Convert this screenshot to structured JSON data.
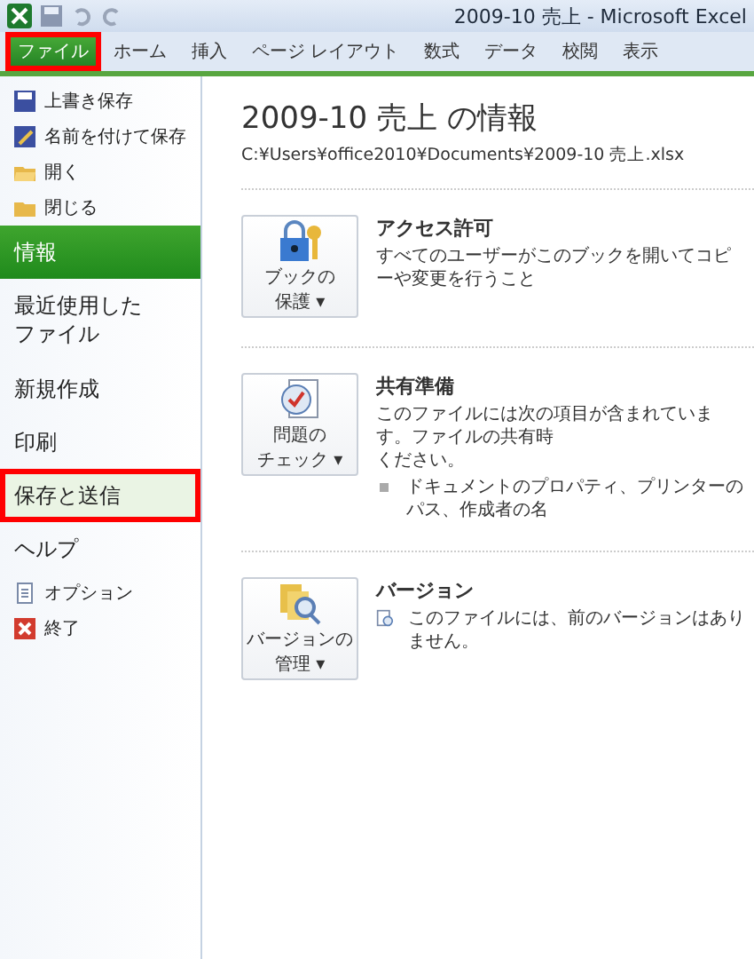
{
  "window": {
    "title": "2009-10 売上 - Microsoft Excel"
  },
  "tabs": [
    {
      "label": "ファイル",
      "kind": "file",
      "selected": true,
      "highlighted": true
    },
    {
      "label": "ホーム",
      "kind": "tab",
      "selected": false,
      "highlighted": false
    },
    {
      "label": "挿入",
      "kind": "tab",
      "selected": false,
      "highlighted": false
    },
    {
      "label": "ページ レイアウト",
      "kind": "tab",
      "selected": false,
      "highlighted": false
    },
    {
      "label": "数式",
      "kind": "tab",
      "selected": false,
      "highlighted": false
    },
    {
      "label": "データ",
      "kind": "tab",
      "selected": false,
      "highlighted": false
    },
    {
      "label": "校閲",
      "kind": "tab",
      "selected": false,
      "highlighted": false
    },
    {
      "label": "表示",
      "kind": "tab",
      "selected": false,
      "highlighted": false
    }
  ],
  "sidebar": {
    "items": [
      {
        "label": "上書き保存",
        "kind": "small",
        "selected": false,
        "highlighted": false
      },
      {
        "label": "名前を付けて保存",
        "kind": "small",
        "selected": false,
        "highlighted": false
      },
      {
        "label": "開く",
        "kind": "small",
        "selected": false,
        "highlighted": false
      },
      {
        "label": "閉じる",
        "kind": "small",
        "selected": false,
        "highlighted": false
      },
      {
        "label": "情報",
        "kind": "large",
        "selected": true,
        "highlighted": false
      },
      {
        "lines": [
          "最近使用した",
          "ファイル"
        ],
        "kind": "large",
        "selected": false,
        "highlighted": false
      },
      {
        "label": "新規作成",
        "kind": "large",
        "selected": false,
        "highlighted": false
      },
      {
        "label": "印刷",
        "kind": "large",
        "selected": false,
        "highlighted": false
      },
      {
        "label": "保存と送信",
        "kind": "large",
        "selected": false,
        "highlighted": true
      },
      {
        "label": "ヘルプ",
        "kind": "large",
        "selected": false,
        "highlighted": false
      },
      {
        "label": "オプション",
        "kind": "small",
        "selected": false,
        "highlighted": false
      },
      {
        "label": "終了",
        "kind": "small",
        "selected": false,
        "highlighted": false
      }
    ]
  },
  "info": {
    "title": "2009-10 売上 の情報",
    "path": "C:¥Users¥office2010¥Documents¥2009-10 売上.xlsx",
    "sections": [
      {
        "button": [
          "ブックの",
          "保護 ▾"
        ],
        "heading": "アクセス許可",
        "text": [
          "すべてのユーザーがこのブックを開いてコピーや変更を行うこと"
        ]
      },
      {
        "button": [
          "問題の",
          "チェック ▾"
        ],
        "heading": "共有準備",
        "text": [
          "このファイルには次の項目が含まれています。ファイルの共有時",
          "ください。"
        ],
        "bullets": [
          "ドキュメントのプロパティ、プリンターのパス、作成者の名"
        ]
      },
      {
        "button": [
          "バージョンの",
          "管理 ▾"
        ],
        "heading": "バージョン",
        "note": "このファイルには、前のバージョンはありません。"
      }
    ]
  }
}
